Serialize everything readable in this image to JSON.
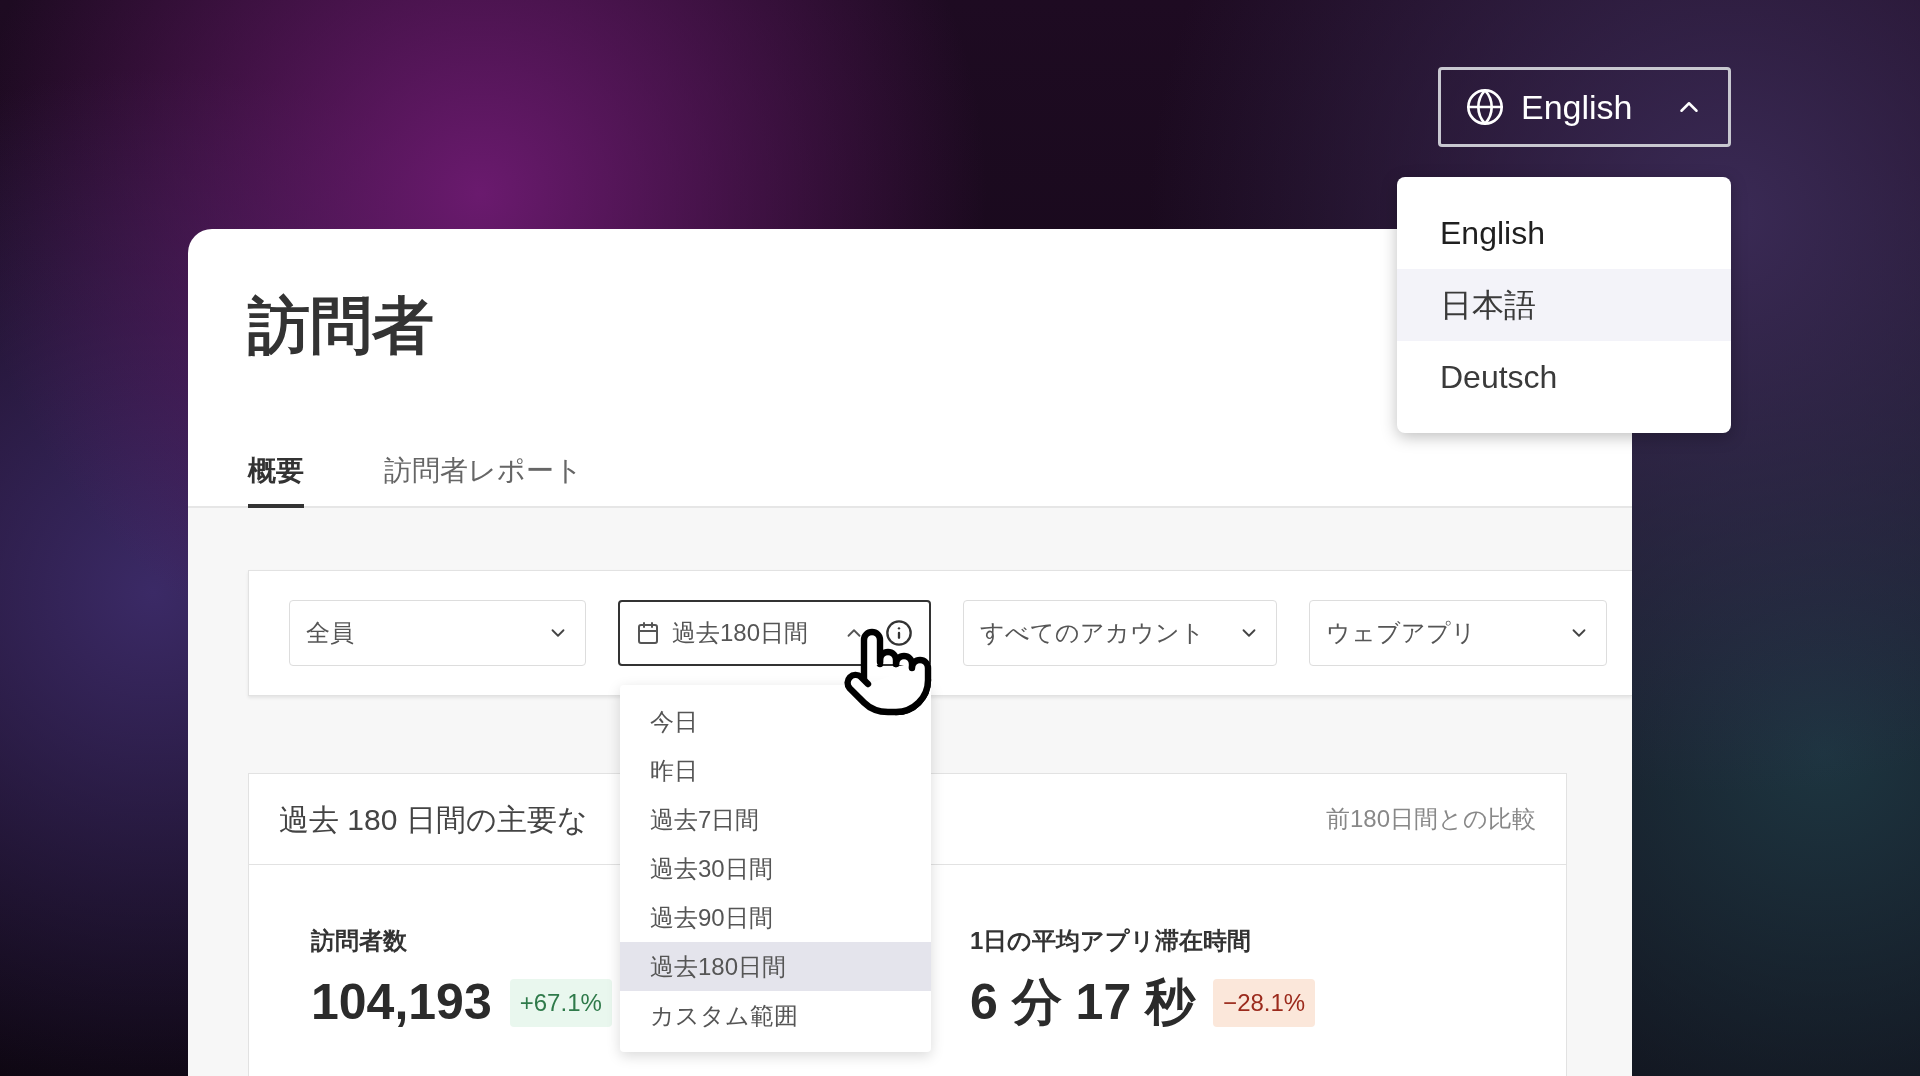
{
  "language_selector": {
    "value": "English",
    "expanded": true,
    "options": [
      {
        "label": "English",
        "selected": true,
        "highlighted": false
      },
      {
        "label": "日本語",
        "selected": false,
        "highlighted": true
      },
      {
        "label": "Deutsch",
        "selected": false,
        "highlighted": false
      }
    ]
  },
  "page": {
    "title": "訪問者"
  },
  "tabs": [
    {
      "label": "概要",
      "selected": true
    },
    {
      "label": "訪問者レポート",
      "selected": false
    }
  ],
  "filters": [
    {
      "kind": "select",
      "value": "全員"
    },
    {
      "kind": "date",
      "value": "過去180日間",
      "expanded": true,
      "options": [
        {
          "label": "今日",
          "selected": false
        },
        {
          "label": "昨日",
          "selected": false
        },
        {
          "label": "過去7日間",
          "selected": false
        },
        {
          "label": "過去30日間",
          "selected": false
        },
        {
          "label": "過去90日間",
          "selected": false
        },
        {
          "label": "過去180日間",
          "selected": true
        },
        {
          "label": "カスタム範囲",
          "selected": false
        }
      ]
    },
    {
      "kind": "select",
      "value": "すべてのアカウント"
    },
    {
      "kind": "select",
      "value": "ウェブアプリ"
    }
  ],
  "metrics": {
    "title": "過去 180 日間の主要な",
    "comparison": "前180日間との比較",
    "items": [
      {
        "label": "訪問者数",
        "value": "104,193",
        "change": "+67.1%",
        "kind": "up"
      },
      {
        "label": "1日の平均アプリ滞在時間",
        "value": "6 分 17 秒",
        "change": "−28.1%",
        "kind": "down"
      }
    ]
  }
}
